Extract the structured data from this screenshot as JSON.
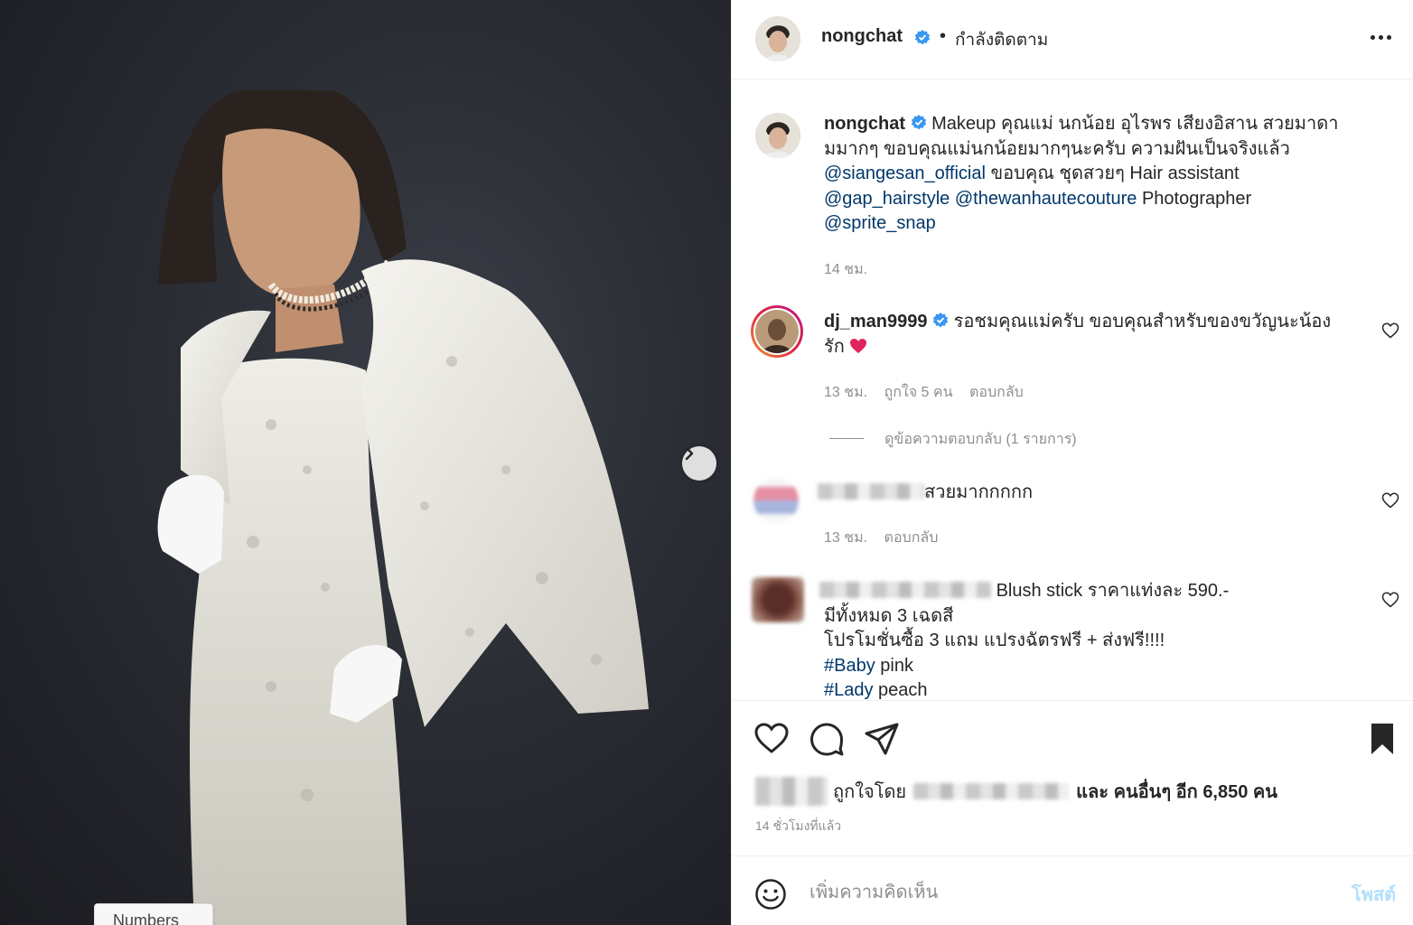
{
  "post": {
    "username": "nongchat",
    "follow_status": "กำลังติดตาม",
    "separator": "•",
    "caption_line1": "Makeup คุณแม่ นกน้อย อุไรพร เสียงอิสาน สวยมาดา",
    "caption_line2": "มมากๆ ขอบคุณแม่นกน้อยมากๆนะครับ ความฝันเป็นจริงแล้ว",
    "mention_siangesan": "@siangesan_official",
    "caption_line3_rest": " ขอบคุณ ชุดสวยๆ Hair assistant",
    "mention_gap": "@gap_hairstyle",
    "mention_thewan": "@thewanhautecouture",
    "caption_line4_rest": " Photographer",
    "mention_sprite": "@sprite_snap",
    "caption_time": "14 ชม."
  },
  "comments": [
    {
      "username": "dj_man9999",
      "text_line1": "รอชมคุณแม่ครับ ขอบคุณสำหรับของขวัญนะน้อง",
      "text_line2": "รัก",
      "time": "13 ชม.",
      "likes": "ถูกใจ 5 คน",
      "reply": "ตอบกลับ",
      "view_replies": "ดูข้อความตอบกลับ (1 รายการ)"
    },
    {
      "text": "สวยมากกกกก",
      "time": "13 ชม.",
      "reply": "ตอบกลับ"
    },
    {
      "text_line1": "Blush stick ราคาแท่งละ 590.-",
      "text_line2": "มีทั้งหมด 3 เฉดสี",
      "text_line3": "โปรโมชั่นซื้อ 3 แถม แปรงฉัตรฟรี + ส่งฟรี!!!!",
      "hashtag1": "#Baby",
      "hashtag1_rest": " pink",
      "hashtag2": "#Lady",
      "hashtag2_rest": " peach"
    }
  ],
  "actions": {
    "liked_by_prefix": "ถูกใจโดย",
    "liked_by_suffix": "และ คนอื่นๆ อีก 6,850 คน",
    "time_ago": "14 ชั่วโมงที่แล้ว"
  },
  "composer": {
    "placeholder": "เพิ่มความคิดเห็น",
    "post_label": "โพสต์",
    "tooltip": "Numbers"
  },
  "colors": {
    "verified": "#3897f0",
    "mention": "#00376b",
    "muted": "#8e8e8e",
    "post_disabled": "#b2dffc"
  },
  "icons": [
    "chevron-right-icon",
    "more-icon",
    "verified-icon",
    "heart-icon",
    "comment-icon",
    "share-icon",
    "bookmark-icon",
    "emoji-icon"
  ]
}
